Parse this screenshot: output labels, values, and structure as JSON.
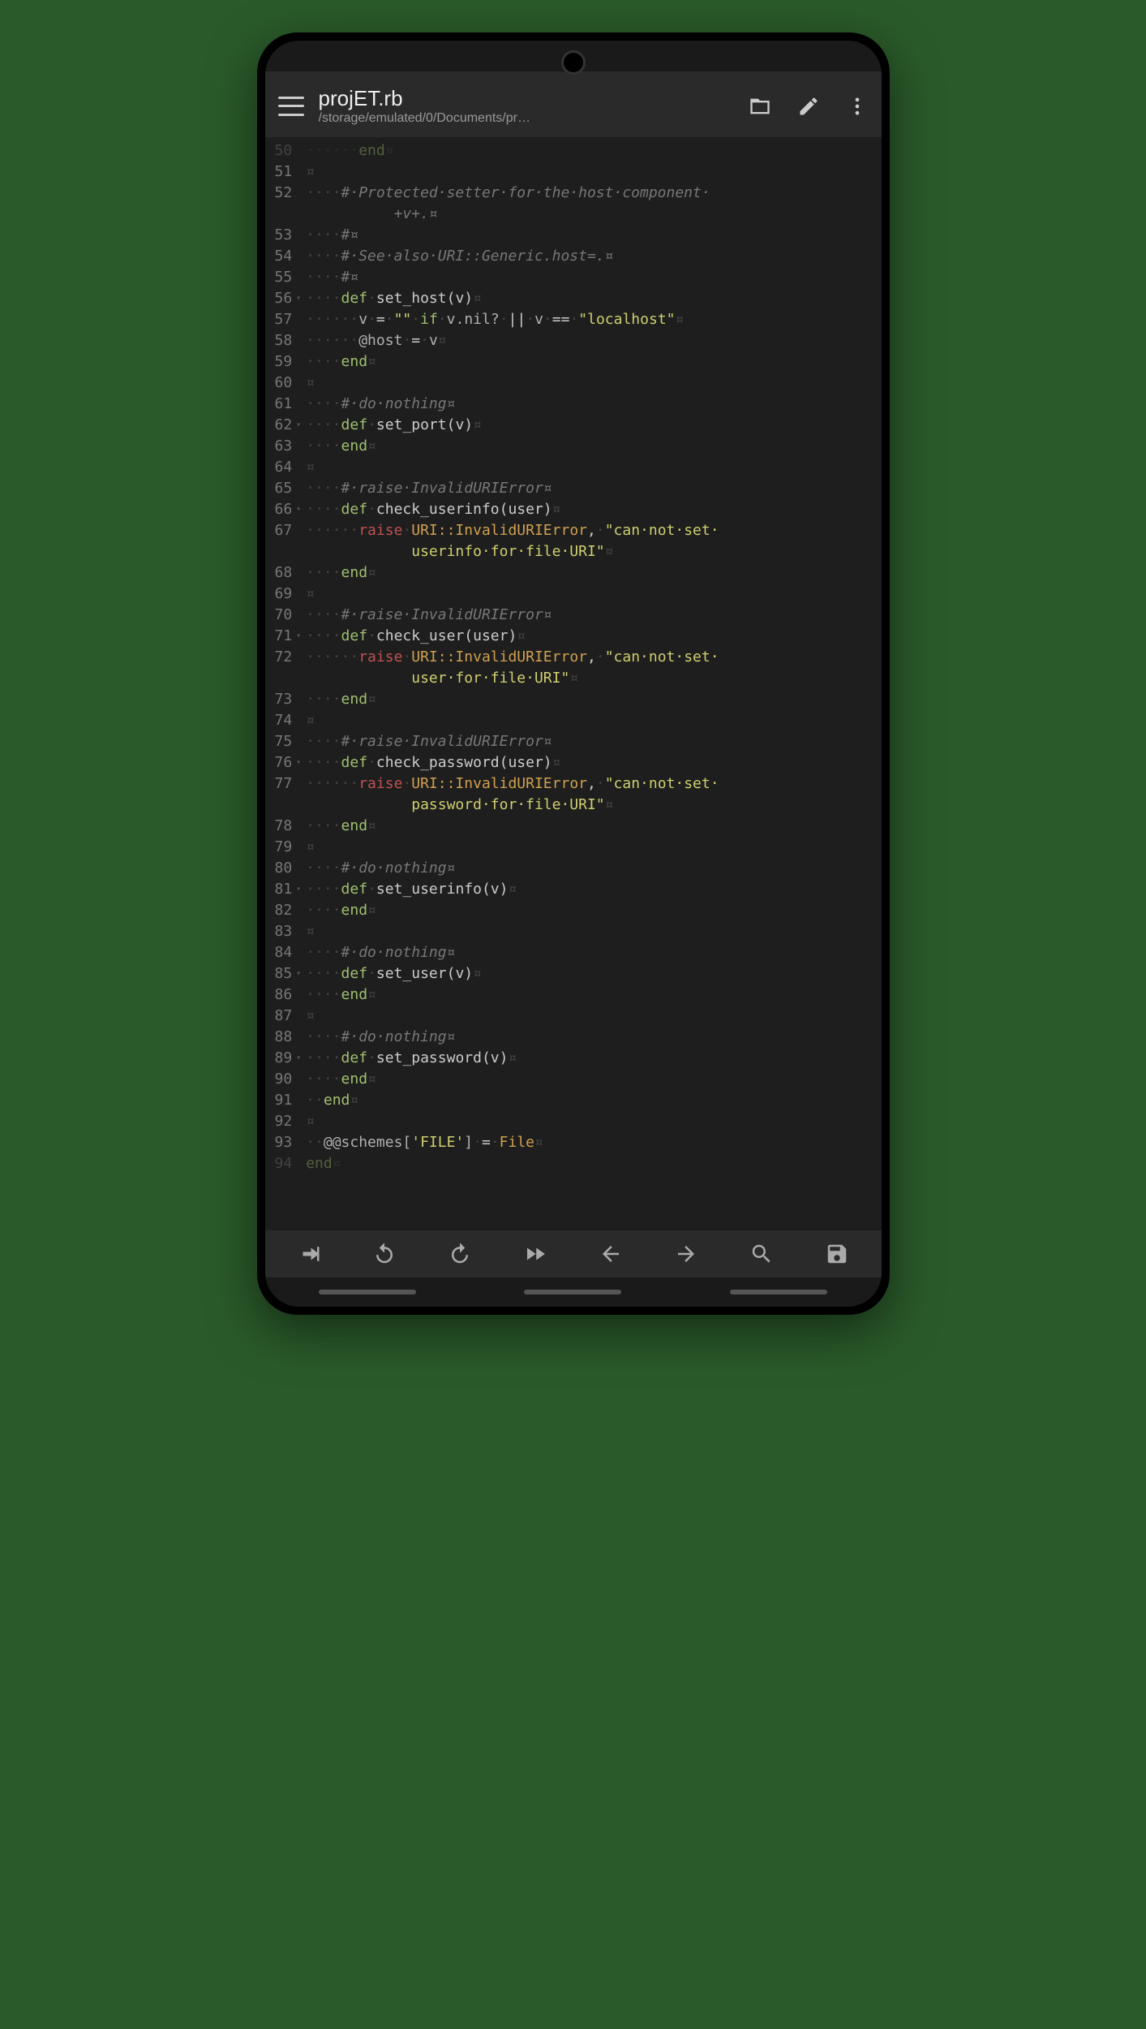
{
  "header": {
    "title": "projET.rb",
    "subtitle": "/storage/emulated/0/Documents/pr…"
  },
  "gutter_start": 50,
  "fold_lines": [
    56,
    62,
    66,
    71,
    76,
    81,
    85,
    89
  ],
  "code_lines": [
    {
      "n": 50,
      "seg": [
        {
          "t": "ws",
          "v": "······"
        },
        {
          "t": "kw",
          "v": "end"
        },
        {
          "t": "ws",
          "v": "¤"
        }
      ],
      "faded": true
    },
    {
      "n": 51,
      "seg": [
        {
          "t": "ws",
          "v": "¤"
        }
      ]
    },
    {
      "n": 52,
      "seg": [
        {
          "t": "ws",
          "v": "····"
        },
        {
          "t": "cm",
          "v": "#·Protected·setter·for·the·host·component·"
        }
      ]
    },
    {
      "n": 52,
      "cont": true,
      "seg": [
        {
          "t": "ws",
          "v": "          "
        },
        {
          "t": "cm",
          "v": "+v+.¤"
        }
      ]
    },
    {
      "n": 53,
      "seg": [
        {
          "t": "ws",
          "v": "····"
        },
        {
          "t": "cm",
          "v": "#¤"
        }
      ]
    },
    {
      "n": 54,
      "seg": [
        {
          "t": "ws",
          "v": "····"
        },
        {
          "t": "cm",
          "v": "#·See·also·URI::Generic.host=.¤"
        }
      ]
    },
    {
      "n": 55,
      "seg": [
        {
          "t": "ws",
          "v": "····"
        },
        {
          "t": "cm",
          "v": "#¤"
        }
      ]
    },
    {
      "n": 56,
      "seg": [
        {
          "t": "ws",
          "v": "····"
        },
        {
          "t": "kw",
          "v": "def"
        },
        {
          "t": "ws",
          "v": "·"
        },
        {
          "t": "fn",
          "v": "set_host(v)"
        },
        {
          "t": "ws",
          "v": "¤"
        }
      ]
    },
    {
      "n": 57,
      "seg": [
        {
          "t": "ws",
          "v": "······"
        },
        {
          "t": "var",
          "v": "v"
        },
        {
          "t": "ws",
          "v": "·"
        },
        {
          "t": "op",
          "v": "="
        },
        {
          "t": "ws",
          "v": "·"
        },
        {
          "t": "str",
          "v": "\"\""
        },
        {
          "t": "ws",
          "v": "·"
        },
        {
          "t": "kw",
          "v": "if"
        },
        {
          "t": "ws",
          "v": "·"
        },
        {
          "t": "var",
          "v": "v.nil?"
        },
        {
          "t": "ws",
          "v": "·"
        },
        {
          "t": "op",
          "v": "||"
        },
        {
          "t": "ws",
          "v": "·"
        },
        {
          "t": "var",
          "v": "v"
        },
        {
          "t": "ws",
          "v": "·"
        },
        {
          "t": "op",
          "v": "=="
        },
        {
          "t": "ws",
          "v": "·"
        },
        {
          "t": "str",
          "v": "\"localhost\""
        },
        {
          "t": "ws",
          "v": "¤"
        }
      ]
    },
    {
      "n": 58,
      "seg": [
        {
          "t": "ws",
          "v": "······"
        },
        {
          "t": "var",
          "v": "@host"
        },
        {
          "t": "ws",
          "v": "·"
        },
        {
          "t": "op",
          "v": "="
        },
        {
          "t": "ws",
          "v": "·"
        },
        {
          "t": "var",
          "v": "v"
        },
        {
          "t": "ws",
          "v": "¤"
        }
      ]
    },
    {
      "n": 59,
      "seg": [
        {
          "t": "ws",
          "v": "····"
        },
        {
          "t": "kw",
          "v": "end"
        },
        {
          "t": "ws",
          "v": "¤"
        }
      ]
    },
    {
      "n": 60,
      "seg": [
        {
          "t": "ws",
          "v": "¤"
        }
      ]
    },
    {
      "n": 61,
      "seg": [
        {
          "t": "ws",
          "v": "····"
        },
        {
          "t": "cm",
          "v": "#·do·nothing¤"
        }
      ]
    },
    {
      "n": 62,
      "seg": [
        {
          "t": "ws",
          "v": "····"
        },
        {
          "t": "kw",
          "v": "def"
        },
        {
          "t": "ws",
          "v": "·"
        },
        {
          "t": "fn",
          "v": "set_port(v)"
        },
        {
          "t": "ws",
          "v": "¤"
        }
      ]
    },
    {
      "n": 63,
      "seg": [
        {
          "t": "ws",
          "v": "····"
        },
        {
          "t": "kw",
          "v": "end"
        },
        {
          "t": "ws",
          "v": "¤"
        }
      ]
    },
    {
      "n": 64,
      "seg": [
        {
          "t": "ws",
          "v": "¤"
        }
      ]
    },
    {
      "n": 65,
      "seg": [
        {
          "t": "ws",
          "v": "····"
        },
        {
          "t": "cm",
          "v": "#·raise·InvalidURIError¤"
        }
      ]
    },
    {
      "n": 66,
      "seg": [
        {
          "t": "ws",
          "v": "····"
        },
        {
          "t": "kw",
          "v": "def"
        },
        {
          "t": "ws",
          "v": "·"
        },
        {
          "t": "fn",
          "v": "check_userinfo(user)"
        },
        {
          "t": "ws",
          "v": "¤"
        }
      ]
    },
    {
      "n": 67,
      "seg": [
        {
          "t": "ws",
          "v": "······"
        },
        {
          "t": "err",
          "v": "raise"
        },
        {
          "t": "ws",
          "v": "·"
        },
        {
          "t": "const",
          "v": "URI::InvalidURIError"
        },
        {
          "t": "op",
          "v": ","
        },
        {
          "t": "ws",
          "v": "·"
        },
        {
          "t": "str",
          "v": "\"can·not·set·"
        }
      ]
    },
    {
      "n": 67,
      "cont": true,
      "seg": [
        {
          "t": "ws",
          "v": "            "
        },
        {
          "t": "str",
          "v": "userinfo·for·file·URI\""
        },
        {
          "t": "ws",
          "v": "¤"
        }
      ]
    },
    {
      "n": 68,
      "seg": [
        {
          "t": "ws",
          "v": "····"
        },
        {
          "t": "kw",
          "v": "end"
        },
        {
          "t": "ws",
          "v": "¤"
        }
      ]
    },
    {
      "n": 69,
      "seg": [
        {
          "t": "ws",
          "v": "¤"
        }
      ]
    },
    {
      "n": 70,
      "seg": [
        {
          "t": "ws",
          "v": "····"
        },
        {
          "t": "cm",
          "v": "#·raise·InvalidURIError¤"
        }
      ]
    },
    {
      "n": 71,
      "seg": [
        {
          "t": "ws",
          "v": "····"
        },
        {
          "t": "kw",
          "v": "def"
        },
        {
          "t": "ws",
          "v": "·"
        },
        {
          "t": "fn",
          "v": "check_user(user)"
        },
        {
          "t": "ws",
          "v": "¤"
        }
      ]
    },
    {
      "n": 72,
      "seg": [
        {
          "t": "ws",
          "v": "······"
        },
        {
          "t": "err",
          "v": "raise"
        },
        {
          "t": "ws",
          "v": "·"
        },
        {
          "t": "const",
          "v": "URI::InvalidURIError"
        },
        {
          "t": "op",
          "v": ","
        },
        {
          "t": "ws",
          "v": "·"
        },
        {
          "t": "str",
          "v": "\"can·not·set·"
        }
      ]
    },
    {
      "n": 72,
      "cont": true,
      "seg": [
        {
          "t": "ws",
          "v": "            "
        },
        {
          "t": "str",
          "v": "user·for·file·URI\""
        },
        {
          "t": "ws",
          "v": "¤"
        }
      ]
    },
    {
      "n": 73,
      "seg": [
        {
          "t": "ws",
          "v": "····"
        },
        {
          "t": "kw",
          "v": "end"
        },
        {
          "t": "ws",
          "v": "¤"
        }
      ]
    },
    {
      "n": 74,
      "seg": [
        {
          "t": "ws",
          "v": "¤"
        }
      ]
    },
    {
      "n": 75,
      "seg": [
        {
          "t": "ws",
          "v": "····"
        },
        {
          "t": "cm",
          "v": "#·raise·InvalidURIError¤"
        }
      ]
    },
    {
      "n": 76,
      "seg": [
        {
          "t": "ws",
          "v": "····"
        },
        {
          "t": "kw",
          "v": "def"
        },
        {
          "t": "ws",
          "v": "·"
        },
        {
          "t": "fn",
          "v": "check_password(user)"
        },
        {
          "t": "ws",
          "v": "¤"
        }
      ]
    },
    {
      "n": 77,
      "seg": [
        {
          "t": "ws",
          "v": "······"
        },
        {
          "t": "err",
          "v": "raise"
        },
        {
          "t": "ws",
          "v": "·"
        },
        {
          "t": "const",
          "v": "URI::InvalidURIError"
        },
        {
          "t": "op",
          "v": ","
        },
        {
          "t": "ws",
          "v": "·"
        },
        {
          "t": "str",
          "v": "\"can·not·set·"
        }
      ]
    },
    {
      "n": 77,
      "cont": true,
      "seg": [
        {
          "t": "ws",
          "v": "            "
        },
        {
          "t": "str",
          "v": "password·for·file·URI\""
        },
        {
          "t": "ws",
          "v": "¤"
        }
      ]
    },
    {
      "n": 78,
      "seg": [
        {
          "t": "ws",
          "v": "····"
        },
        {
          "t": "kw",
          "v": "end"
        },
        {
          "t": "ws",
          "v": "¤"
        }
      ]
    },
    {
      "n": 79,
      "seg": [
        {
          "t": "ws",
          "v": "¤"
        }
      ]
    },
    {
      "n": 80,
      "seg": [
        {
          "t": "ws",
          "v": "····"
        },
        {
          "t": "cm",
          "v": "#·do·nothing¤"
        }
      ]
    },
    {
      "n": 81,
      "seg": [
        {
          "t": "ws",
          "v": "····"
        },
        {
          "t": "kw",
          "v": "def"
        },
        {
          "t": "ws",
          "v": "·"
        },
        {
          "t": "fn",
          "v": "set_userinfo(v)"
        },
        {
          "t": "ws",
          "v": "¤"
        }
      ]
    },
    {
      "n": 82,
      "seg": [
        {
          "t": "ws",
          "v": "····"
        },
        {
          "t": "kw",
          "v": "end"
        },
        {
          "t": "ws",
          "v": "¤"
        }
      ]
    },
    {
      "n": 83,
      "seg": [
        {
          "t": "ws",
          "v": "¤"
        }
      ]
    },
    {
      "n": 84,
      "seg": [
        {
          "t": "ws",
          "v": "····"
        },
        {
          "t": "cm",
          "v": "#·do·nothing¤"
        }
      ]
    },
    {
      "n": 85,
      "seg": [
        {
          "t": "ws",
          "v": "····"
        },
        {
          "t": "kw",
          "v": "def"
        },
        {
          "t": "ws",
          "v": "·"
        },
        {
          "t": "fn",
          "v": "set_user(v)"
        },
        {
          "t": "ws",
          "v": "¤"
        }
      ]
    },
    {
      "n": 86,
      "seg": [
        {
          "t": "ws",
          "v": "····"
        },
        {
          "t": "kw",
          "v": "end"
        },
        {
          "t": "ws",
          "v": "¤"
        }
      ]
    },
    {
      "n": 87,
      "seg": [
        {
          "t": "ws",
          "v": "¤"
        }
      ]
    },
    {
      "n": 88,
      "seg": [
        {
          "t": "ws",
          "v": "····"
        },
        {
          "t": "cm",
          "v": "#·do·nothing¤"
        }
      ]
    },
    {
      "n": 89,
      "seg": [
        {
          "t": "ws",
          "v": "····"
        },
        {
          "t": "kw",
          "v": "def"
        },
        {
          "t": "ws",
          "v": "·"
        },
        {
          "t": "fn",
          "v": "set_password(v)"
        },
        {
          "t": "ws",
          "v": "¤"
        }
      ]
    },
    {
      "n": 90,
      "seg": [
        {
          "t": "ws",
          "v": "····"
        },
        {
          "t": "kw",
          "v": "end"
        },
        {
          "t": "ws",
          "v": "¤"
        }
      ]
    },
    {
      "n": 91,
      "seg": [
        {
          "t": "ws",
          "v": "··"
        },
        {
          "t": "kw",
          "v": "end"
        },
        {
          "t": "ws",
          "v": "¤"
        }
      ]
    },
    {
      "n": 92,
      "seg": [
        {
          "t": "ws",
          "v": "¤"
        }
      ]
    },
    {
      "n": 93,
      "seg": [
        {
          "t": "ws",
          "v": "··"
        },
        {
          "t": "var",
          "v": "@@schemes["
        },
        {
          "t": "str",
          "v": "'FILE'"
        },
        {
          "t": "var",
          "v": "]"
        },
        {
          "t": "ws",
          "v": "·"
        },
        {
          "t": "op",
          "v": "="
        },
        {
          "t": "ws",
          "v": "·"
        },
        {
          "t": "const",
          "v": "File"
        },
        {
          "t": "ws",
          "v": "¤"
        }
      ]
    },
    {
      "n": 94,
      "seg": [
        {
          "t": "kw",
          "v": "end"
        },
        {
          "t": "ws",
          "v": "¤"
        }
      ],
      "faded": true
    }
  ],
  "bottom_actions": [
    "tab",
    "undo",
    "redo",
    "fast-forward",
    "left",
    "right",
    "search",
    "save"
  ]
}
